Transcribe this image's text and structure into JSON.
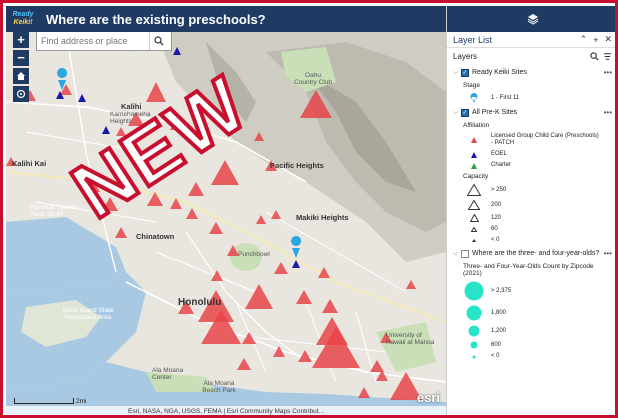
{
  "header": {
    "logo_line1": "Ready",
    "logo_line2": "Keiki!",
    "title": "Where are the existing preschools?"
  },
  "map": {
    "search_placeholder": "Find address or place",
    "zoom_in": "+",
    "zoom_out": "−",
    "stamp": "NEW",
    "labels": [
      "Kalihi",
      "Kamehameha Heights",
      "Kalihi Kai",
      "Honolulu Harbor-Piers 39-40",
      "Chinatown",
      "Pacific Heights",
      "Makiki Heights",
      "Punchbowl",
      "Oahu Country Club",
      "Sand Island State Recreation Area",
      "Ala Moana Beach Park",
      "Ala Moana Center",
      "Honolulu",
      "University of Hawaii at Manoa"
    ],
    "scale_label": "2mi",
    "attribution": "Esri, NASA, NGA, USGS, FEMA | Esri Community Maps Contribut...",
    "esri_logo": "esri"
  },
  "panel": {
    "title": "Layer List",
    "layers_label": "Layers",
    "layer1": {
      "name": "Ready Keiki Sites",
      "legend_title": "Stage",
      "legend_items": [
        "1 - First 11"
      ]
    },
    "layer2": {
      "name": "All Pre-K Sites",
      "affiliation_title": "Affiliation",
      "affiliation_items": [
        {
          "label": "Licensed Group Child Care (Preschools) - PATCH",
          "color": "#e8444a"
        },
        {
          "label": "EOEL",
          "color": "#1a1aa8"
        },
        {
          "label": "Charter",
          "color": "#2e9e3e"
        }
      ],
      "capacity_title": "Capacity",
      "capacity_items": [
        "> 250",
        "200",
        "120",
        "60",
        "< 0"
      ]
    },
    "layer3": {
      "name": "Where are the three- and four-year-olds?",
      "legend_title": "Three- and Four-Year-Olds Count by Zipcode (2021)",
      "legend_items": [
        "> 2,375",
        "1,800",
        "1,200",
        "600",
        "< 0"
      ],
      "color": "#27e3c8"
    }
  }
}
